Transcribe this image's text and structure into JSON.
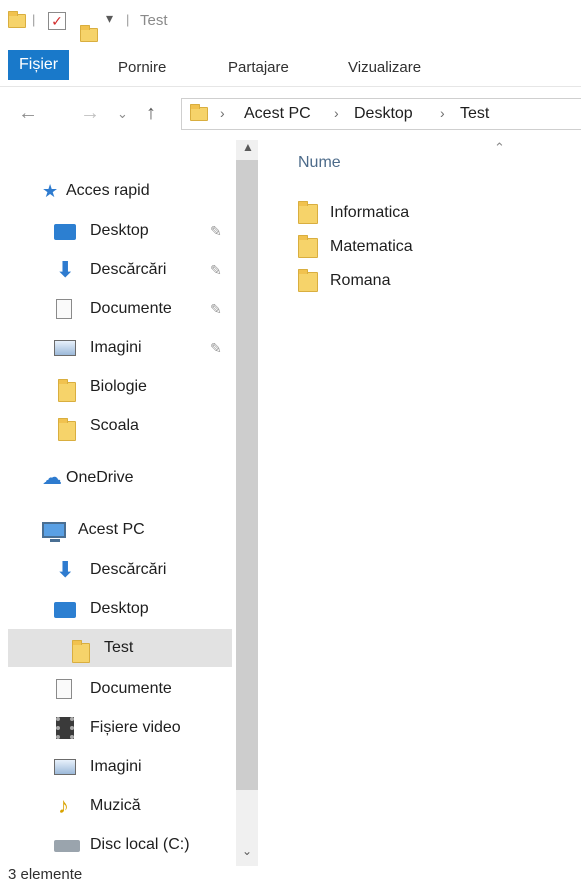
{
  "window": {
    "title": "Test"
  },
  "ribbon": {
    "tabs": [
      "Fișier",
      "Pornire",
      "Partajare",
      "Vizualizare"
    ]
  },
  "address": {
    "crumbs": [
      "Acest PC",
      "Desktop",
      "Test"
    ]
  },
  "nav": {
    "quick_access": "Acces rapid",
    "items": [
      {
        "label": "Desktop"
      },
      {
        "label": "Descărcări"
      },
      {
        "label": "Documente"
      },
      {
        "label": "Imagini"
      },
      {
        "label": "Biologie"
      },
      {
        "label": "Scoala"
      }
    ],
    "onedrive": "OneDrive",
    "this_pc": "Acest PC",
    "pc_items": [
      {
        "label": "Descărcări"
      },
      {
        "label": "Desktop"
      },
      {
        "label": "Test"
      },
      {
        "label": "Documente"
      },
      {
        "label": "Fișiere video"
      },
      {
        "label": "Imagini"
      },
      {
        "label": "Muzică"
      },
      {
        "label": "Disc local (C:)"
      }
    ]
  },
  "content": {
    "column_header": "Nume",
    "files": [
      {
        "name": "Informatica"
      },
      {
        "name": "Matematica"
      },
      {
        "name": "Romana"
      }
    ]
  },
  "status": {
    "text": "3 elemente"
  }
}
